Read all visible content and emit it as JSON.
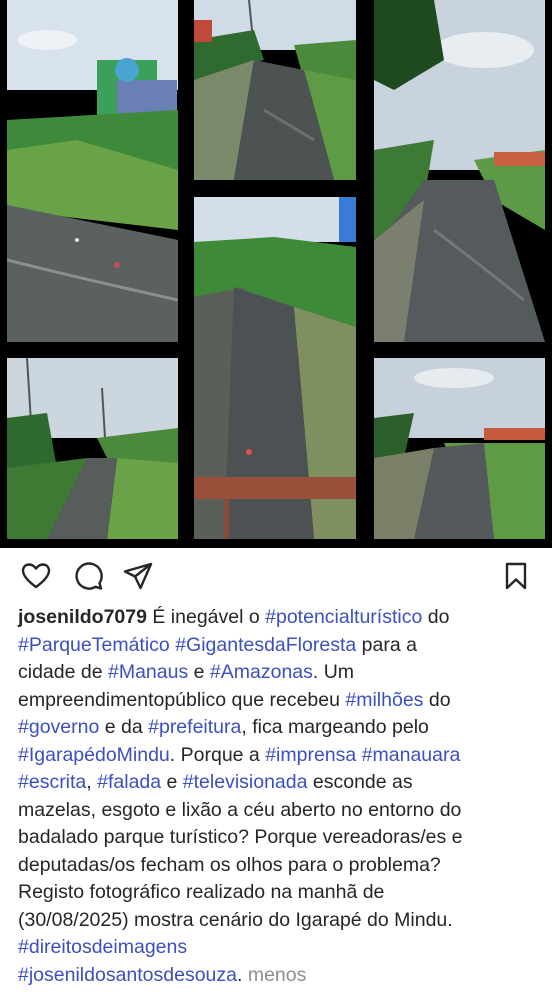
{
  "post": {
    "username": "josenildo7079",
    "caption_lines": [
      [
        {
          "t": "text",
          "v": " É inegável o "
        },
        {
          "t": "tag",
          "v": "#potencialturístico"
        },
        {
          "t": "text",
          "v": " do"
        }
      ],
      [
        {
          "t": "tag",
          "v": "#ParqueTemático"
        },
        {
          "t": "text",
          "v": " "
        },
        {
          "t": "tag",
          "v": "#GigantesdaFloresta"
        },
        {
          "t": "text",
          "v": " para a"
        }
      ],
      [
        {
          "t": "text",
          "v": "cidade de "
        },
        {
          "t": "tag",
          "v": "#Manaus"
        },
        {
          "t": "text",
          "v": " e "
        },
        {
          "t": "tag",
          "v": "#Amazonas"
        },
        {
          "t": "text",
          "v": ". Um"
        }
      ],
      [
        {
          "t": "text",
          "v": "empreendimentopúblico que recebeu "
        },
        {
          "t": "tag",
          "v": "#milhões"
        },
        {
          "t": "text",
          "v": " do"
        }
      ],
      [
        {
          "t": "tag",
          "v": "#governo"
        },
        {
          "t": "text",
          "v": " e da "
        },
        {
          "t": "tag",
          "v": "#prefeitura"
        },
        {
          "t": "text",
          "v": ", fica margeando pelo"
        }
      ],
      [
        {
          "t": "tag",
          "v": "#IgarapédoMindu"
        },
        {
          "t": "text",
          "v": ".  Porque a "
        },
        {
          "t": "tag",
          "v": "#imprensa"
        },
        {
          "t": "text",
          "v": " "
        },
        {
          "t": "tag",
          "v": "#manauara"
        }
      ],
      [
        {
          "t": "tag",
          "v": "#escrita"
        },
        {
          "t": "text",
          "v": ", "
        },
        {
          "t": "tag",
          "v": "#falada"
        },
        {
          "t": "text",
          "v": " e "
        },
        {
          "t": "tag",
          "v": "#televisionada"
        },
        {
          "t": "text",
          "v": " esconde as"
        }
      ],
      [
        {
          "t": "text",
          "v": "mazelas,  esgoto e lixão a céu aberto no entorno do"
        }
      ],
      [
        {
          "t": "text",
          "v": "badalado parque turístico? Porque vereadoras/es e"
        }
      ],
      [
        {
          "t": "text",
          "v": "deputadas/os fecham os olhos para o problema?"
        }
      ],
      [
        {
          "t": "text",
          "v": "Registo fotográfico realizado na manhã de"
        }
      ],
      [
        {
          "t": "text",
          "v": "(30/08/2025) mostra cenário do Igarapé do Mindu."
        }
      ],
      [
        {
          "t": "tag",
          "v": "#direitosdeimagens"
        }
      ],
      [
        {
          "t": "tag",
          "v": "#josenildosantosdesouza"
        },
        {
          "t": "text",
          "v": ". "
        },
        {
          "t": "more",
          "v": "menos"
        }
      ]
    ]
  },
  "actions": {
    "icons": [
      "heart-icon",
      "comment-icon",
      "share-icon",
      "bookmark-icon"
    ]
  },
  "colors": {
    "hashtag": "#3b4fc0",
    "text": "#262626",
    "muted": "#8e8e8e",
    "background": "#ffffff",
    "collage_background": "#000000"
  }
}
